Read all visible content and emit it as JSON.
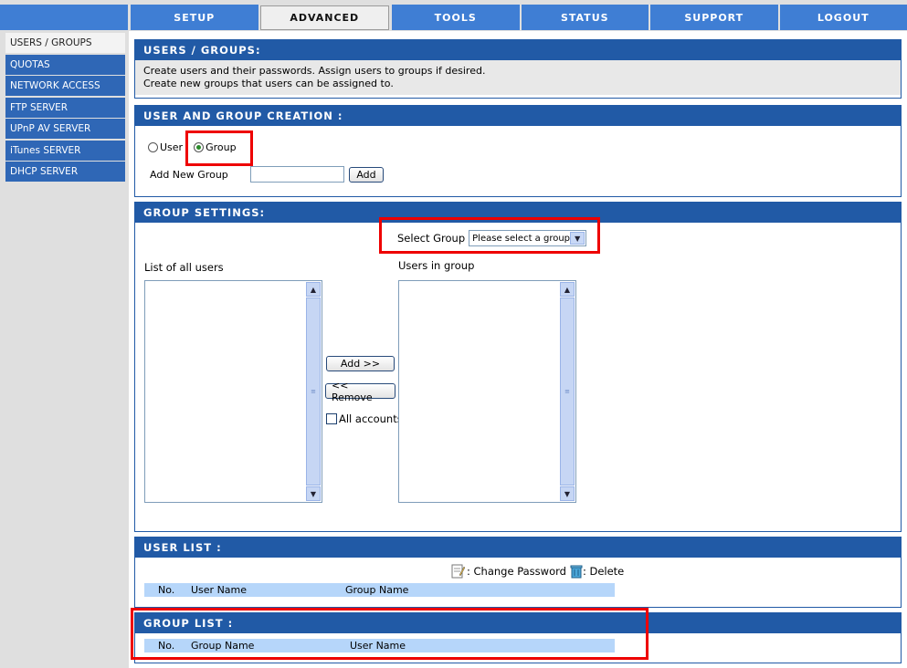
{
  "tabs": [
    "SETUP",
    "ADVANCED",
    "TOOLS",
    "STATUS",
    "SUPPORT",
    "LOGOUT"
  ],
  "sidebar": [
    "USERS / GROUPS",
    "QUOTAS",
    "NETWORK ACCESS",
    "FTP SERVER",
    "UPnP AV SERVER",
    "iTunes SERVER",
    "DHCP SERVER"
  ],
  "intro": {
    "title": "USERS / GROUPS:",
    "line1": "Create users and their passwords. Assign users to groups if desired.",
    "line2": "Create new groups that users can be assigned to."
  },
  "creation": {
    "title": "USER AND GROUP CREATION :",
    "user_label": "User",
    "group_label": "Group",
    "add_new_group_label": "Add New Group",
    "add_button": "Add"
  },
  "group_settings": {
    "title": "GROUP SETTINGS:",
    "select_label": "Select Group",
    "select_value": "Please select a group",
    "all_users_label": "List of all users",
    "users_in_group_label": "Users in group",
    "add_button": "Add >>",
    "remove_button": "<< Remove",
    "all_accounts_label": "All accounts"
  },
  "user_list": {
    "title": "USER LIST :",
    "change_password": ": Change Password",
    "delete": ": Delete",
    "col_no": "No.",
    "col_user_name": "User Name",
    "col_group_name": "Group Name"
  },
  "group_list": {
    "title": "GROUP LIST :",
    "col_no": "No.",
    "col_group_name": "Group Name",
    "col_user_name": "User Name"
  },
  "colors": {
    "nav_blue": "#3f7ed4",
    "header_blue": "#215aa6",
    "highlight_red": "#ee0000"
  }
}
